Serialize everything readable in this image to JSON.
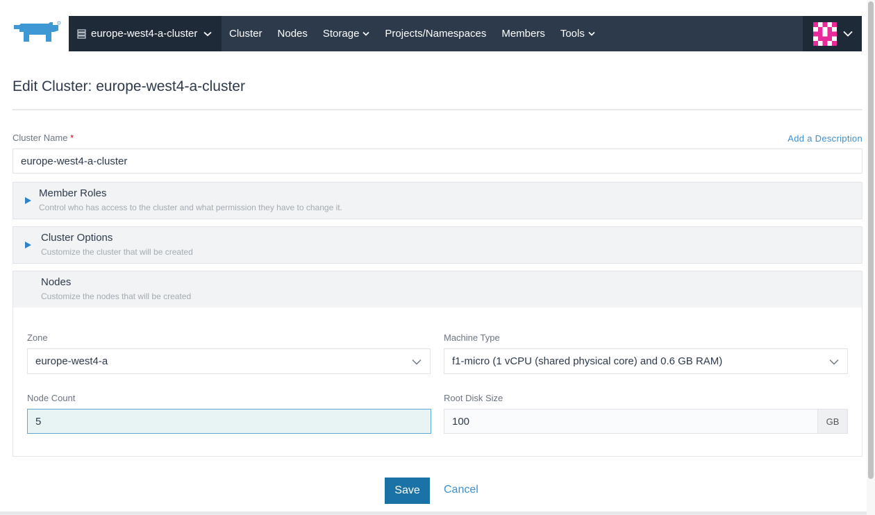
{
  "topnav": {
    "cluster_switch_label": "europe-west4-a-cluster",
    "items": [
      {
        "label": "Cluster"
      },
      {
        "label": "Nodes"
      },
      {
        "label": "Storage"
      },
      {
        "label": "Projects/Namespaces"
      },
      {
        "label": "Members"
      },
      {
        "label": "Tools"
      }
    ],
    "logo_icon": "rancher-bull-logo",
    "avatar_icon": "pixel-avatar",
    "colors": {
      "nav_bg": "#2c3a4b",
      "nav_active_bg": "#1e2a38",
      "logo": "#3d98d3",
      "avatar": "#e82a9a"
    }
  },
  "header": {
    "title": "Edit Cluster: europe-west4-a-cluster"
  },
  "cluster_name": {
    "label": "Cluster Name",
    "required_marker": "*",
    "value": "europe-west4-a-cluster",
    "add_description_link": "Add a Description"
  },
  "sections": [
    {
      "title": "Member Roles",
      "subtitle": "Control who has access to the cluster and what permission they have to change it."
    },
    {
      "title": "Cluster Options",
      "subtitle": "Customize the cluster that will be created"
    },
    {
      "title": "Nodes",
      "subtitle": "Customize the nodes that will be created"
    }
  ],
  "nodes": {
    "zone": {
      "label": "Zone",
      "value": "europe-west4-a"
    },
    "machine_type": {
      "label": "Machine Type",
      "value": "f1-micro (1 vCPU (shared physical core) and 0.6 GB RAM)"
    },
    "node_count": {
      "label": "Node Count",
      "value": "5"
    },
    "root_disk_size": {
      "label": "Root Disk Size",
      "value": "100",
      "unit": "GB"
    }
  },
  "actions": {
    "save_label": "Save",
    "cancel_label": "Cancel",
    "primary_color": "#1b72a6",
    "link_color": "#3d8fcf"
  }
}
